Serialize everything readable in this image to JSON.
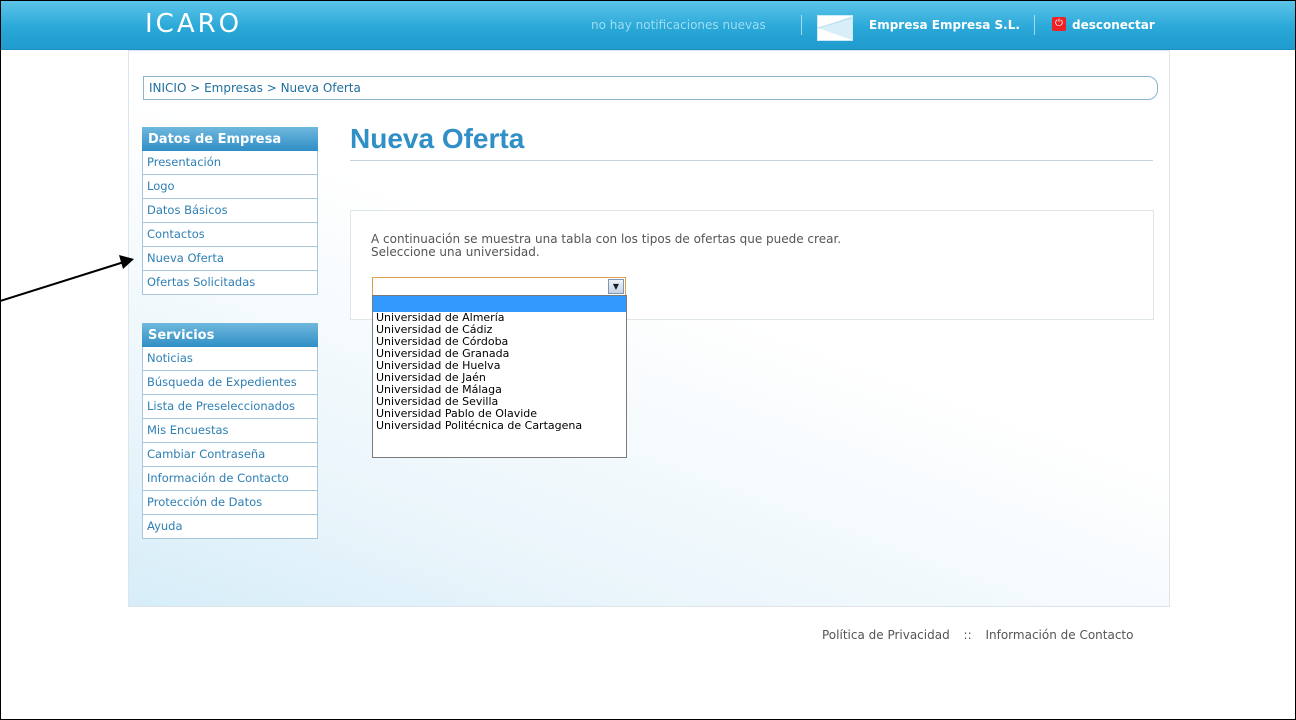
{
  "header": {
    "logo": "ICARO",
    "notifications": "no hay notificaciones nuevas",
    "company": "Empresa Empresa S.L.",
    "logout": "desconectar"
  },
  "breadcrumb": "INICIO > Empresas > Nueva Oferta",
  "sidebar": {
    "company_box": {
      "title": "Datos de Empresa",
      "items": [
        "Presentación",
        "Logo",
        "Datos Básicos",
        "Contactos",
        "Nueva Oferta",
        "Ofertas Solicitadas"
      ]
    },
    "services_box": {
      "title": "Servicios",
      "items": [
        "Noticias",
        "Búsqueda de Expedientes",
        "Lista de Preseleccionados",
        "Mis Encuestas",
        "Cambiar Contraseña",
        "Información de Contacto",
        "Protección de Datos",
        "Ayuda"
      ]
    }
  },
  "main": {
    "title": "Nueva Oferta",
    "intro_line1": "A continuación se muestra una tabla con los tipos de ofertas que puede crear.",
    "intro_line2": "Seleccione una universidad.",
    "select_value": "",
    "options": [
      "Universidad de Almería",
      "Universidad de Cádiz",
      "Universidad de Córdoba",
      "Universidad de Granada",
      "Universidad de Huelva",
      "Universidad de Jaén",
      "Universidad de Málaga",
      "Universidad de Sevilla",
      "Universidad Pablo de Olavide",
      "Universidad Politécnica de Cartagena"
    ]
  },
  "footer": {
    "privacy": "Política de Privacidad",
    "separator": "::",
    "contact": "Información de Contacto"
  },
  "colors": {
    "header": "#2aa8d8",
    "accent": "#2f8fc6",
    "highlight": "#3399ff"
  }
}
